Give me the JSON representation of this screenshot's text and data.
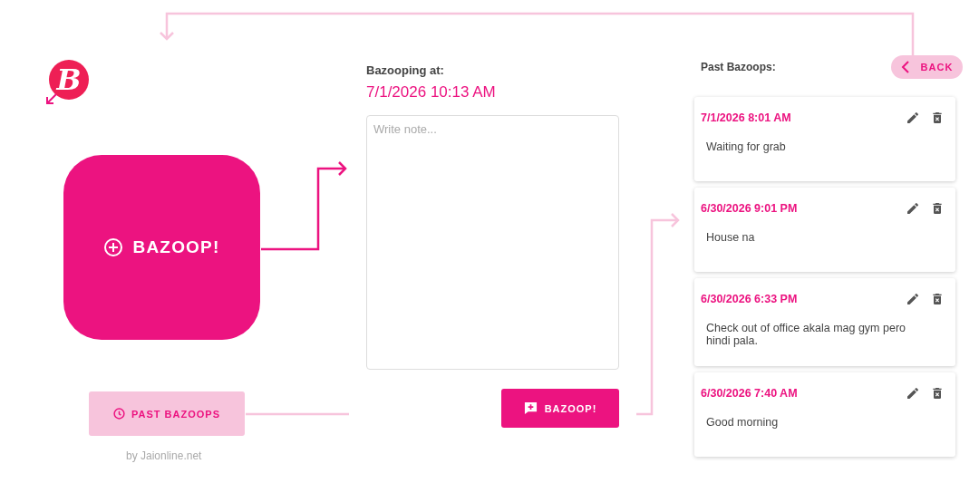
{
  "home": {
    "logo": {
      "letter": "B"
    },
    "main_button": "BAZOOP!",
    "past_button": "PAST BAZOOPS",
    "credit": "by Jaionline.net"
  },
  "compose": {
    "label": "Bazooping at:",
    "timestamp": "7/1/2026 10:13 AM",
    "note": {
      "placeholder": "Write note..."
    },
    "submit_button": "BAZOOP!"
  },
  "history": {
    "title": "Past Bazoops:",
    "back_button": "BACK",
    "entries": [
      {
        "timestamp": "7/1/2026 8:01 AM",
        "note": "Waiting for grab"
      },
      {
        "timestamp": "6/30/2026 9:01 PM",
        "note": "House na"
      },
      {
        "timestamp": "6/30/2026 6:33 PM",
        "note": "Check out of office akala mag gym pero hindi pala."
      },
      {
        "timestamp": "6/30/2026 7:40 AM",
        "note": "Good morning"
      }
    ]
  }
}
